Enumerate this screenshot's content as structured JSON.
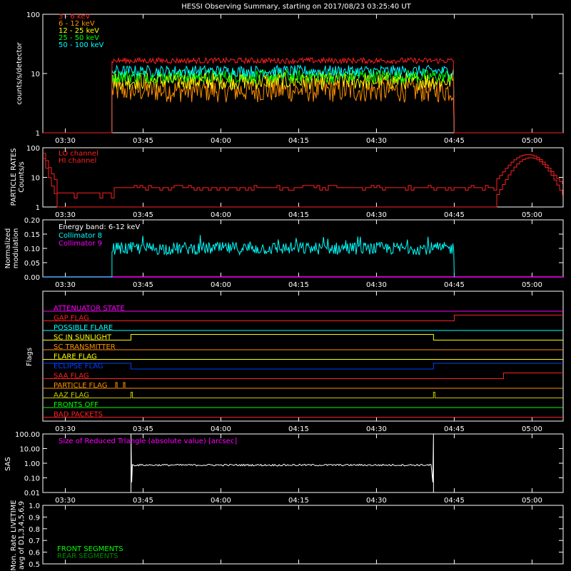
{
  "title": "HESSI Observing Summary, starting on 2017/08/23 03:25:40 UT",
  "time_ticks": [
    "03:30",
    "03:45",
    "04:00",
    "04:15",
    "04:30",
    "04:45",
    "05:00"
  ],
  "time_range_min": [
    205,
    337
  ],
  "panels": {
    "lightcurve": {
      "ylabel": "counts/s/detector",
      "yticks": [
        "1",
        "10",
        "100"
      ],
      "legend": [
        {
          "label": "3 - 6 keV",
          "color": "#ff2020"
        },
        {
          "label": "6 - 12 keV",
          "color": "#ff9000"
        },
        {
          "label": "12 - 25 keV",
          "color": "#ffff00"
        },
        {
          "label": "25 - 50 keV",
          "color": "#00ff00"
        },
        {
          "label": "50 - 100 keV",
          "color": "#00ffff"
        }
      ]
    },
    "particle": {
      "ylabel_1": "PARTICLE RATES",
      "ylabel_2": "Counts/s",
      "yticks": [
        "1",
        "10",
        "100"
      ],
      "legend": [
        {
          "label": "LO channel",
          "color": "#ff2020"
        },
        {
          "label": "HI channel",
          "color": "#ff2020"
        }
      ]
    },
    "modulation": {
      "ylabel_1": "Normalized",
      "ylabel_2": "modulation",
      "yticks": [
        "0.00",
        "0.05",
        "0.10",
        "0.15",
        "0.20"
      ],
      "legend_title": "Energy band: 6-12 keV",
      "legend": [
        {
          "label": "Collimator 8",
          "color": "#00ffff"
        },
        {
          "label": "Collimator 9",
          "color": "#ff00ff"
        }
      ]
    },
    "flags": {
      "ylabel": "Flags",
      "items": [
        {
          "label": "ATTENUATOR STATE",
          "color": "#ff00ff"
        },
        {
          "label": "GAP FLAG",
          "color": "#ff2020"
        },
        {
          "label": "POSSIBLE FLARE",
          "color": "#00ffff"
        },
        {
          "label": "SC IN SUNLIGHT",
          "color": "#ffff00"
        },
        {
          "label": "SC TRANSMITTER",
          "color": "#ff9000"
        },
        {
          "label": "FLARE FLAG",
          "color": "#ffff00"
        },
        {
          "label": "ECLIPSE FLAG",
          "color": "#0040ff"
        },
        {
          "label": "SAA FLAG",
          "color": "#ff2020"
        },
        {
          "label": "PARTICLE FLAG",
          "color": "#ff9000"
        },
        {
          "label": "AAZ FLAG",
          "color": "#c8c800"
        },
        {
          "label": "FRONTS OFF",
          "color": "#00ff00"
        },
        {
          "label": "BAD PACKETS",
          "color": "#ff2020"
        }
      ]
    },
    "sas": {
      "ylabel": "SAS",
      "yticks": [
        "0.01",
        "0.10",
        "1.00",
        "10.00",
        "100.00"
      ],
      "legend": "Size of Reduced Triangle (absolute value) [arcsec]",
      "legend_color": "#ff00ff"
    },
    "livetime": {
      "ylabel_1": "Mon. Rate LIVETIME",
      "ylabel_2": "avg of D1,3,4,5,6,9",
      "yticks": [
        "0.5",
        "0.6",
        "0.7",
        "0.8",
        "0.9",
        "1.0"
      ],
      "legend": [
        {
          "label": "FRONT SEGMENTS",
          "color": "#00ff00"
        },
        {
          "label": "REAR SEGMENTS",
          "color": "#008800"
        }
      ]
    }
  },
  "chart_data": [
    {
      "type": "line",
      "title": "HESSI Observing Summary, starting on 2017/08/23 03:25:40 UT",
      "ylabel": "counts/s/detector",
      "yscale": "log",
      "ylim": [
        1,
        100
      ],
      "xlim": [
        "03:25:40",
        "05:06"
      ],
      "series": [
        {
          "name": "3 - 6 keV",
          "time_range": [
            "03:39",
            "04:45"
          ],
          "mean": 16
        },
        {
          "name": "6 - 12 keV",
          "time_range": [
            "03:39",
            "04:45"
          ],
          "mean": 5
        },
        {
          "name": "12 - 25 keV",
          "time_range": [
            "03:39",
            "04:45"
          ],
          "mean": 8
        },
        {
          "name": "25 - 50 keV",
          "time_range": [
            "03:39",
            "04:45"
          ],
          "mean": 9
        },
        {
          "name": "50 - 100 keV",
          "time_range": [
            "03:39",
            "04:45"
          ],
          "mean": 11
        }
      ]
    },
    {
      "type": "line",
      "ylabel": "PARTICLE RATES Counts/s",
      "yscale": "log",
      "ylim": [
        1,
        100
      ],
      "series": [
        {
          "name": "LO channel",
          "x": [
            "03:26",
            "03:28",
            "03:30",
            "03:38",
            "03:42",
            "03:45",
            "04:00",
            "04:30",
            "04:45",
            "04:53",
            "04:58",
            "05:00",
            "05:03",
            "05:05"
          ],
          "values": [
            60,
            6,
            3,
            3,
            3,
            4.5,
            5,
            5,
            4.5,
            4,
            40,
            55,
            40,
            8
          ]
        },
        {
          "name": "HI channel",
          "x": [
            "03:26",
            "03:28",
            "03:30",
            "04:52",
            "04:56",
            "05:00",
            "05:04"
          ],
          "values": [
            40,
            4,
            1,
            1,
            25,
            45,
            10
          ]
        }
      ]
    },
    {
      "type": "line",
      "ylabel": "Normalized modulation",
      "ylim": [
        0,
        0.2
      ],
      "series": [
        {
          "name": "Collimator 8",
          "time_range": [
            "03:39",
            "04:45"
          ],
          "mean": 0.1
        },
        {
          "name": "Collimator 9",
          "time_range": [
            "03:25:40",
            "05:06"
          ],
          "mean": 0.0
        }
      ]
    },
    {
      "type": "line",
      "ylabel": "SAS",
      "yscale": "log",
      "ylim": [
        0.01,
        100
      ],
      "series": [
        {
          "name": "Size of Reduced Triangle (absolute value) [arcsec]",
          "time_range": [
            "03:43",
            "04:41"
          ],
          "mean": 0.7
        }
      ]
    }
  ]
}
